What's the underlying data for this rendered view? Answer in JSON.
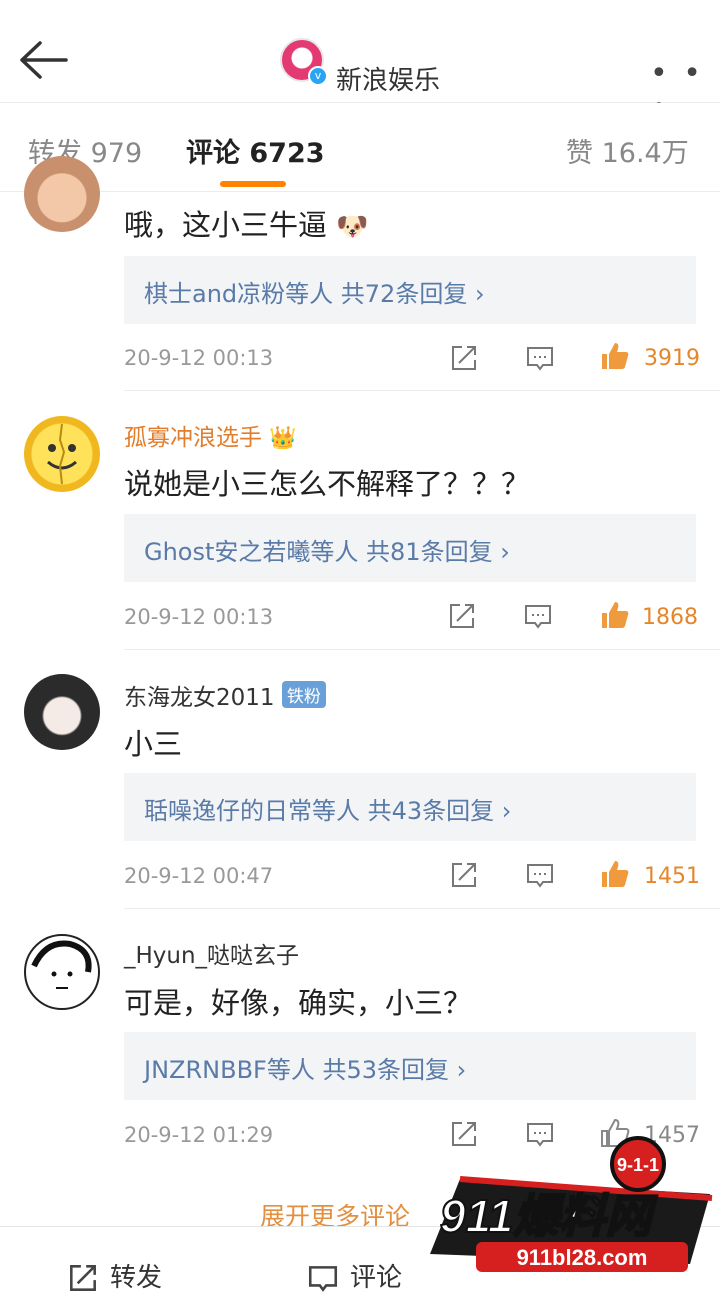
{
  "header": {
    "title": "新浪娱乐",
    "more_label": "• • •"
  },
  "tabs": [
    {
      "label": "转发 979"
    },
    {
      "label": "评论 6723"
    },
    {
      "label": "赞 16.4万"
    }
  ],
  "comments": [
    {
      "user": "",
      "text": "哦，这小三牛逼",
      "replies": "棋士and凉粉等人  共72条回复 ›",
      "time": "20-9-12 00:13",
      "likes": "3919"
    },
    {
      "user": "孤寡冲浪选手",
      "text": "说她是小三怎么不解释了？？？",
      "replies": "Ghost安之若曦等人  共81条回复 ›",
      "time": "20-9-12 00:13",
      "likes": "1868"
    },
    {
      "user": "东海龙女2011",
      "badge": "铁粉",
      "text": "小三",
      "replies": "聒噪逸仔的日常等人  共43条回复 ›",
      "time": "20-9-12 00:47",
      "likes": "1451"
    },
    {
      "user": "_Hyun_哒哒玄子",
      "text": "可是，好像，确实，小三？",
      "replies": "JNZRNBBF等人  共53条回复 ›",
      "time": "20-9-12 01:29",
      "likes": "1457"
    }
  ],
  "expand_label": "展开更多评论",
  "bottom": {
    "repost": "转发",
    "comment": "评论"
  },
  "watermark": {
    "badge": "9-1-1",
    "brand": "911爆料网",
    "url": "911bl28.com"
  },
  "colors": {
    "accent": "#ff8200",
    "link": "#5a7ba8",
    "like": "#e6862b"
  }
}
